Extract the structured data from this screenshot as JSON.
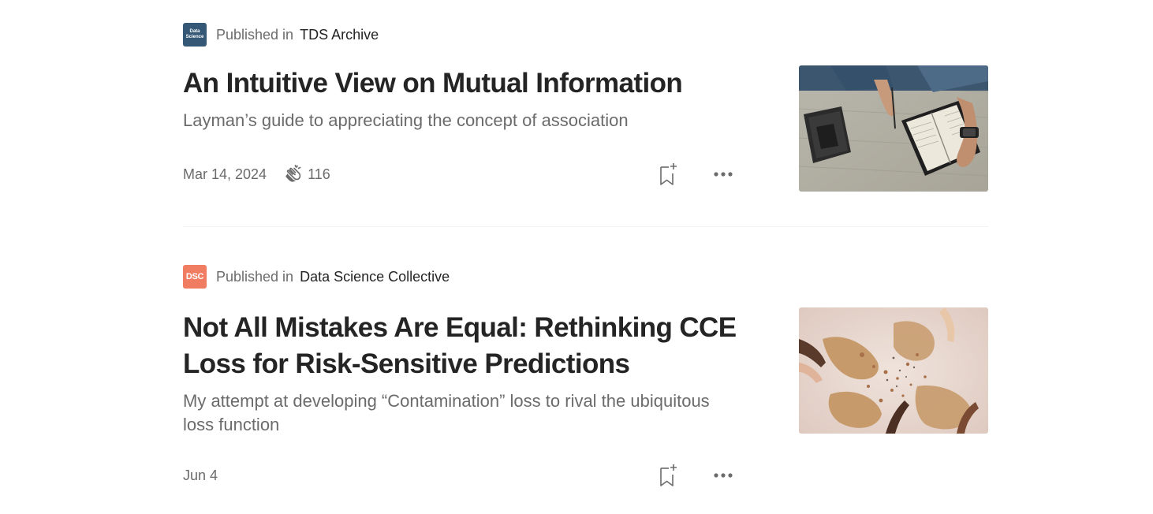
{
  "articles": [
    {
      "publication": {
        "prefix": "Published in",
        "name": "TDS Archive",
        "logo_line1": "Data",
        "logo_line2": "Science",
        "logo_color": "#355876"
      },
      "title": "An Intuitive View on Mutual Information",
      "subtitle": "Layman’s guide to appreciating the concept of association",
      "date": "Mar 14, 2024",
      "claps": "116",
      "thumbnail_icon": "desk-notebook-photo"
    },
    {
      "publication": {
        "prefix": "Published in",
        "name": "Data Science Collective",
        "logo_text": "DSC",
        "logo_color": "#f07c61"
      },
      "title": "Not All Mistakes Are Equal: Rethinking CCE Loss for Risk-Sensitive Predictions",
      "subtitle": "My attempt at developing “Contamination” loss to rival the ubiquitous loss function",
      "date": "Jun 4",
      "thumbnail_icon": "hands-particles-photo"
    }
  ],
  "icons": {
    "clap": "clap-icon",
    "bookmark": "bookmark-add-icon",
    "more": "more-dots-icon"
  },
  "colors": {
    "text_primary": "#242424",
    "text_secondary": "#6b6b6b",
    "divider": "#f2f2f2"
  }
}
